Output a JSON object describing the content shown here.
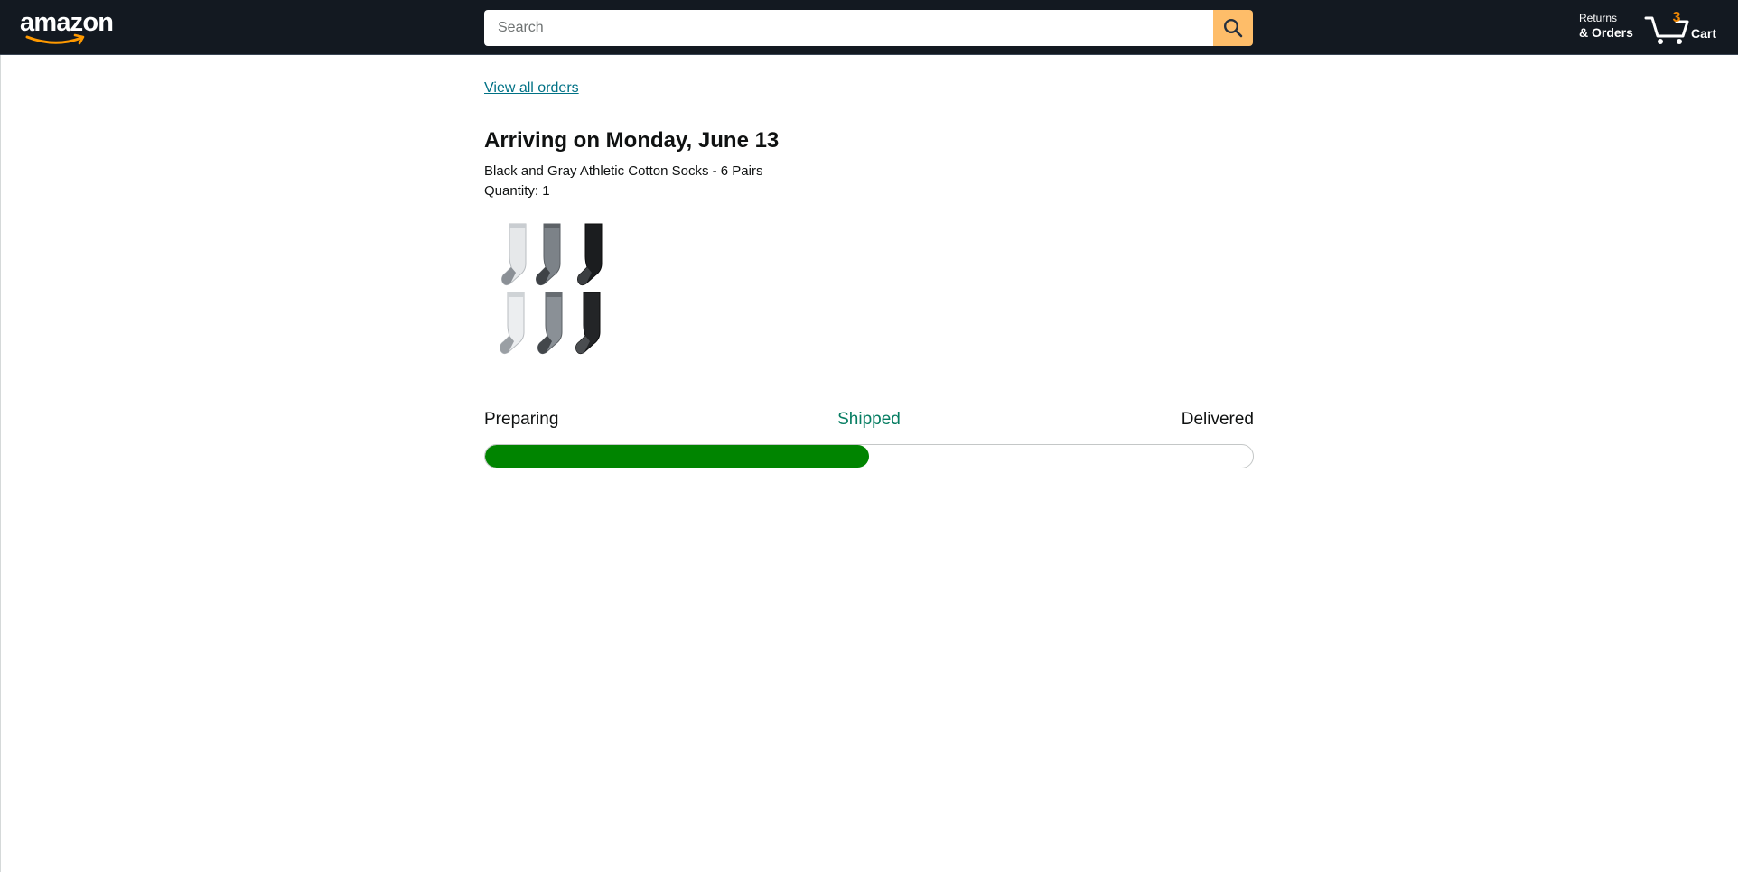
{
  "header": {
    "logo_text": "amazon",
    "search": {
      "placeholder": "Search",
      "value": "",
      "button_icon": "search-icon"
    },
    "returns": {
      "top": "Returns",
      "bottom": "& Orders"
    },
    "cart": {
      "count": "3",
      "label": "Cart",
      "icon": "cart-icon"
    }
  },
  "order": {
    "back_link": "View all orders",
    "arrival_title": "Arriving on Monday, June 13",
    "product_name": "Black and Gray Athletic Cotton Socks - 6 Pairs",
    "quantity_label": "Quantity:",
    "quantity_value": "1",
    "image_alt": "socks-image",
    "progress": {
      "stages": [
        "Preparing",
        "Shipped",
        "Delivered"
      ],
      "current_stage": "Shipped",
      "fraction_complete": 0.5
    }
  },
  "colors": {
    "header_bg": "#131921",
    "search_button": "#febd69",
    "link": "#007185",
    "shipped_text": "#067d62",
    "progress_fill": "#008400",
    "cart_count": "#f08804"
  }
}
